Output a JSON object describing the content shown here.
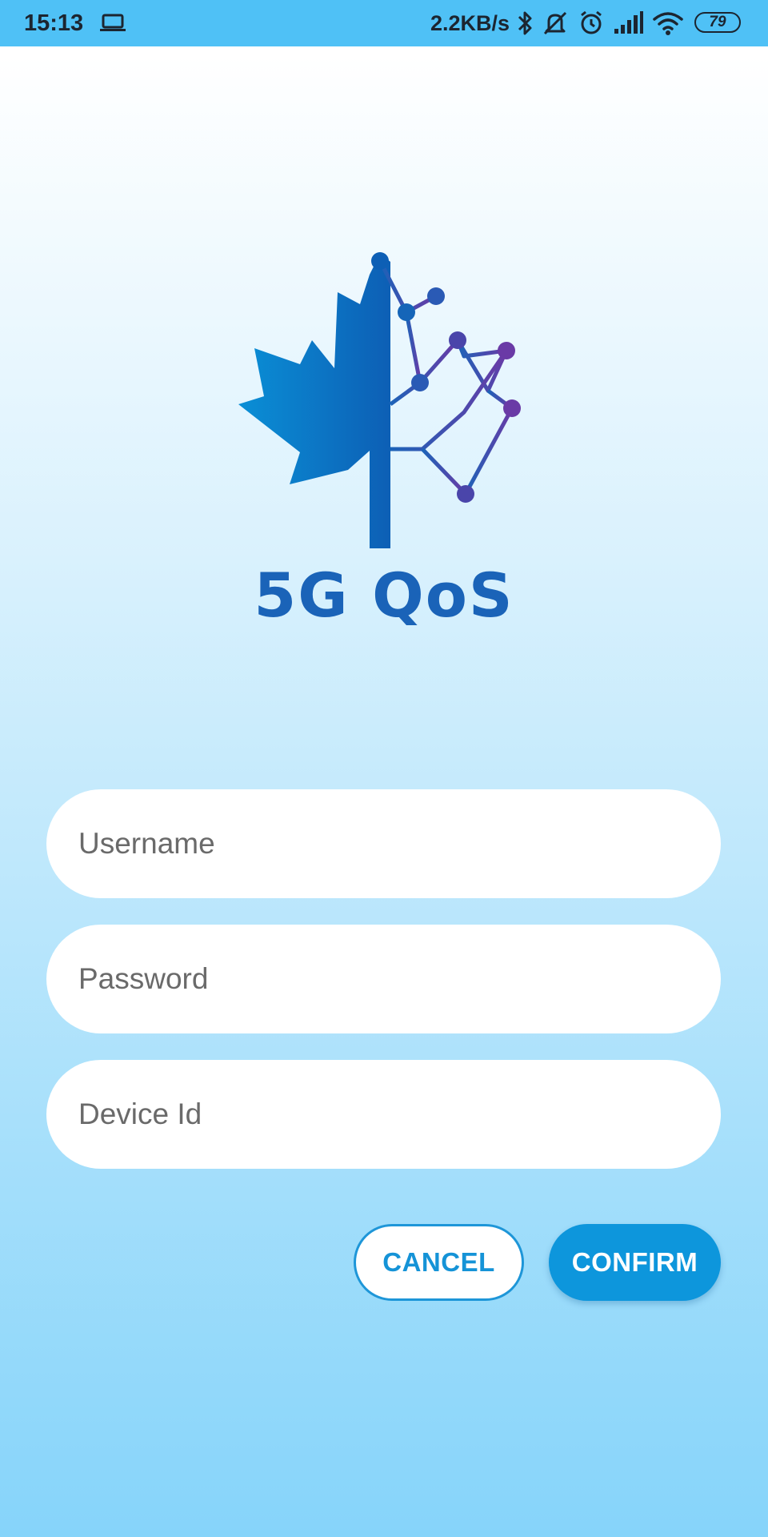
{
  "status_bar": {
    "time": "15:13",
    "net_speed": "2.2KB/s",
    "battery": "79",
    "icons": [
      "laptop-icon",
      "bluetooth-icon",
      "mute-icon",
      "alarm-icon",
      "signal-icon",
      "wifi-icon",
      "battery-icon"
    ]
  },
  "logo": {
    "text": "5G QoS",
    "colors": {
      "blue_light": "#0a8fd6",
      "blue_dark": "#0d5fb5",
      "purple": "#6a3aa6"
    }
  },
  "form": {
    "username_placeholder": "Username",
    "password_placeholder": "Password",
    "device_id_placeholder": "Device Id"
  },
  "buttons": {
    "cancel": "CANCEL",
    "confirm": "CONFIRM"
  },
  "colors": {
    "status_bar": "#4fc1f6",
    "accent": "#0d96dc"
  }
}
